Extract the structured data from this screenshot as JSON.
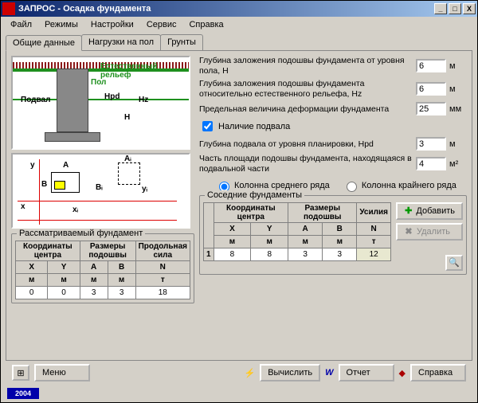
{
  "window": {
    "title": "ЗАПРОС - Осадка фундамента",
    "min": "_",
    "max": "□",
    "close": "X"
  },
  "menu": {
    "file": "Файл",
    "modes": "Режимы",
    "settings": "Настройки",
    "service": "Сервис",
    "help": "Справка"
  },
  "tabs": {
    "general": "Общие данные",
    "loads": "Нагрузки на пол",
    "soils": "Грунты"
  },
  "diagram1": {
    "relief": "Естественный рельеф",
    "floor": "Пол",
    "basement": "Подвал",
    "hpd": "Hpd",
    "hz": "Hz",
    "h": "H"
  },
  "diagram2": {
    "A": "A",
    "B": "B",
    "Ai": "Aᵢ",
    "Bi": "Bᵢ",
    "xi": "xᵢ",
    "yi": "yᵢ",
    "x": "x",
    "y": "y"
  },
  "params": {
    "depth_floor_label": "Глубина заложения подошвы фундамента от уровня пола, H",
    "depth_floor_value": "6",
    "depth_floor_unit": "м",
    "depth_relief_label": "Глубина заложения подошвы фундамента относительно естественного рельефа, Hz",
    "depth_relief_value": "6",
    "depth_relief_unit": "м",
    "deform_label": "Предельная величина деформации фундамента",
    "deform_value": "25",
    "deform_unit": "мм",
    "basement_check_label": "Наличие подвала",
    "basement_depth_label": "Глубина подвала от уровня планировки, Hpd",
    "basement_depth_value": "3",
    "basement_depth_unit": "м",
    "basement_area_label": "Часть площади подошвы фундамента, находящаяся в подвальной части",
    "basement_area_value": "4",
    "basement_area_unit": "м²"
  },
  "radios": {
    "middle": "Колонна среднего ряда",
    "edge": "Колонна крайнего ряда"
  },
  "neighbor_group": "Соседние фундаменты",
  "btn_add": "Добавить",
  "btn_del": "Удалить",
  "neighbor_table": {
    "h_coord": "Координаты центра",
    "h_size": "Размеры подошвы",
    "h_force": "Усилия",
    "X": "X",
    "Y": "Y",
    "A": "A",
    "B": "B",
    "N": "N",
    "uX": "м",
    "uY": "м",
    "uA": "м",
    "uB": "м",
    "uN": "т",
    "row1": {
      "n": "1",
      "X": "8",
      "Y": "8",
      "A": "3",
      "B": "3",
      "N": "12"
    }
  },
  "own_group": "Рассматриваемый фундамент",
  "own_table": {
    "h_coord": "Координаты центра",
    "h_size": "Размеры подошвы",
    "h_force": "Продольная сила",
    "X": "X",
    "Y": "Y",
    "A": "A",
    "B": "B",
    "N": "N",
    "uX": "м",
    "uY": "м",
    "uA": "м",
    "uB": "м",
    "uN": "т",
    "row1": {
      "X": "0",
      "Y": "0",
      "A": "3",
      "B": "3",
      "N": "18"
    }
  },
  "bottom": {
    "menu": "Меню",
    "calc": "Вычислить",
    "report": "Отчет",
    "help": "Справка",
    "year": "2004"
  }
}
